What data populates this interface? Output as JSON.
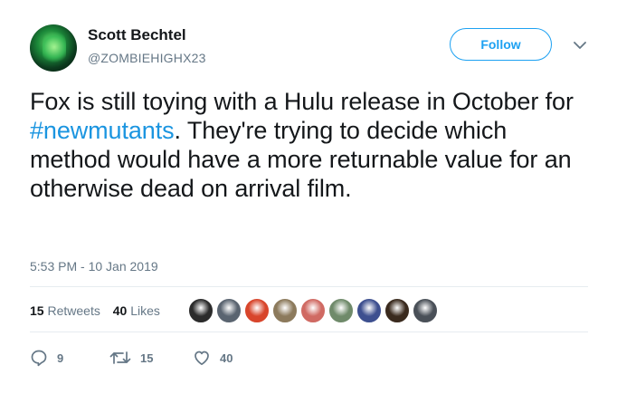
{
  "user": {
    "display_name": "Scott Bechtel",
    "handle": "@ZOMBIEHIGHX23",
    "follow_label": "Follow"
  },
  "tweet": {
    "text_before": "Fox is still toying with a Hulu release in October for ",
    "hashtag": "#newmutants",
    "text_after": ". They're trying to decide which method would have a more returnable value for an otherwise dead on arrival film.",
    "timestamp": "5:53 PM - 10 Jan 2019"
  },
  "stats": {
    "retweets_count": "15",
    "retweets_label": "Retweets",
    "likes_count": "40",
    "likes_label": "Likes"
  },
  "actions": {
    "reply_count": "9",
    "retweet_count": "15",
    "like_count": "40"
  },
  "colors": {
    "accent": "#1da1f2",
    "hashtag": "#1b95e0",
    "muted": "#657786",
    "text": "#14171a",
    "divider": "#e6ecf0"
  },
  "likers": [
    {
      "name": "liker-1",
      "color": "#2b2b2b"
    },
    {
      "name": "liker-2",
      "color": "#5a6470"
    },
    {
      "name": "liker-3",
      "color": "#d8452b"
    },
    {
      "name": "liker-4",
      "color": "#8c7a5c"
    },
    {
      "name": "liker-5",
      "color": "#d06a63"
    },
    {
      "name": "liker-6",
      "color": "#6f8a6a"
    },
    {
      "name": "liker-7",
      "color": "#3d4f8f"
    },
    {
      "name": "liker-8",
      "color": "#3a2a1e"
    },
    {
      "name": "liker-9",
      "color": "#4a5058"
    }
  ]
}
